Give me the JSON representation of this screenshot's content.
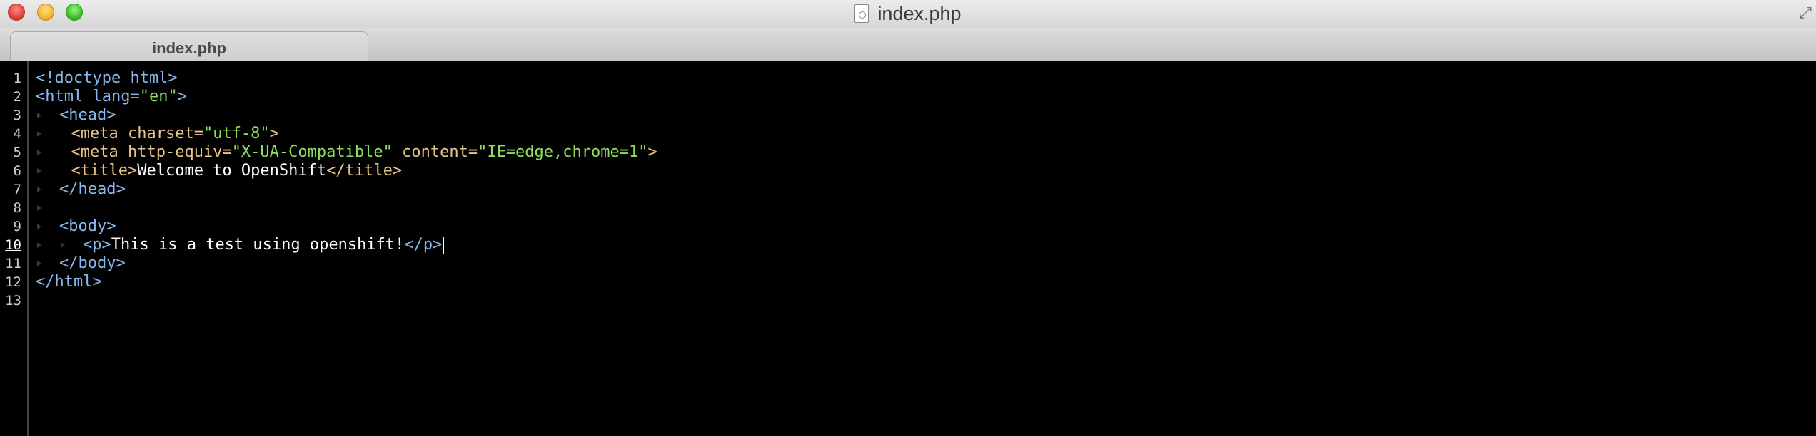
{
  "window": {
    "title": "index.php"
  },
  "tabs": [
    {
      "label": "index.php",
      "active": true
    }
  ],
  "editor": {
    "current_line": 10,
    "lines": [
      {
        "n": "1",
        "indent": 0,
        "guides": 0,
        "segments": [
          [
            "tag",
            "<!doctype html>"
          ]
        ]
      },
      {
        "n": "2",
        "indent": 0,
        "guides": 0,
        "segments": [
          [
            "tag",
            "<html "
          ],
          [
            "tag",
            "lang="
          ],
          [
            "val",
            "\"en\""
          ],
          [
            "tag",
            ">"
          ]
        ]
      },
      {
        "n": "3",
        "indent": 2,
        "guides": 1,
        "segments": [
          [
            "tag",
            "<head>"
          ]
        ]
      },
      {
        "n": "4",
        "indent": 3,
        "guides": 1,
        "segments": [
          [
            "tag2",
            "<meta "
          ],
          [
            "attr",
            "charset="
          ],
          [
            "val",
            "\"utf-8\""
          ],
          [
            "tag2",
            ">"
          ]
        ]
      },
      {
        "n": "5",
        "indent": 3,
        "guides": 1,
        "segments": [
          [
            "tag2",
            "<meta "
          ],
          [
            "attr",
            "http-equiv="
          ],
          [
            "val",
            "\"X-UA-Compatible\""
          ],
          [
            "attr",
            " content="
          ],
          [
            "val",
            "\"IE=edge,chrome=1\""
          ],
          [
            "tag2",
            ">"
          ]
        ]
      },
      {
        "n": "6",
        "indent": 3,
        "guides": 1,
        "segments": [
          [
            "tag2",
            "<title>"
          ],
          [
            "txt",
            "Welcome to OpenShift"
          ],
          [
            "tag2",
            "</title>"
          ]
        ]
      },
      {
        "n": "7",
        "indent": 2,
        "guides": 1,
        "segments": [
          [
            "tag",
            "</head>"
          ]
        ]
      },
      {
        "n": "8",
        "indent": 0,
        "guides": 1,
        "segments": []
      },
      {
        "n": "9",
        "indent": 2,
        "guides": 1,
        "segments": [
          [
            "tag",
            "<body>"
          ]
        ]
      },
      {
        "n": "10",
        "indent": 4,
        "guides": 2,
        "segments": [
          [
            "tag",
            "<p>"
          ],
          [
            "txt",
            "This is a test using openshift!"
          ],
          [
            "tag",
            "</p>"
          ]
        ],
        "caret": true
      },
      {
        "n": "11",
        "indent": 2,
        "guides": 1,
        "segments": [
          [
            "tag",
            "</body>"
          ]
        ]
      },
      {
        "n": "12",
        "indent": 0,
        "guides": 0,
        "segments": [
          [
            "tag",
            "</html>"
          ]
        ]
      },
      {
        "n": "13",
        "indent": 0,
        "guides": 0,
        "segments": []
      }
    ]
  },
  "colors": {
    "background": "#000000",
    "tag": "#8ab8ee",
    "attribute": "#e8c38a",
    "string": "#8ede5a",
    "text": "#ffffff"
  },
  "icons": {
    "close": "close-icon",
    "minimize": "minimize-icon",
    "zoom": "zoom-icon",
    "document": "php-file-icon",
    "fullscreen": "fullscreen-icon"
  }
}
